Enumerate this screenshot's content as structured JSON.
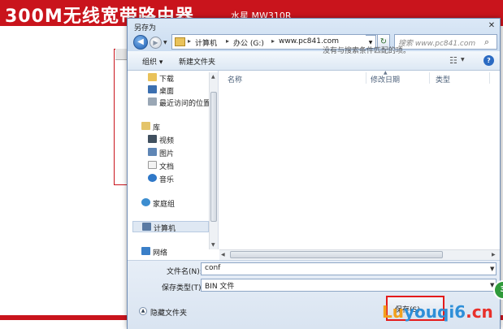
{
  "router_page": {
    "title": "300M无线宽带路由器",
    "model": "水星 MW310R"
  },
  "dialog": {
    "title": "另存为",
    "address": {
      "crumbs": [
        "计算机",
        "办公 (G:)",
        "www.pc841.com"
      ],
      "separator": "▸"
    },
    "search_placeholder": "搜索 www.pc841.com",
    "toolbar": {
      "organize": "组织 ▾",
      "new_folder": "新建文件夹"
    },
    "nav_pane": {
      "items": [
        {
          "label": "下载",
          "icon": "download-folder-icon"
        },
        {
          "label": "桌面",
          "icon": "desktop-icon"
        },
        {
          "label": "最近访问的位置",
          "icon": "recent-places-icon"
        },
        {
          "label": "库",
          "icon": "library-icon"
        },
        {
          "label": "视频",
          "icon": "video-library-icon"
        },
        {
          "label": "图片",
          "icon": "pictures-library-icon"
        },
        {
          "label": "文档",
          "icon": "documents-library-icon"
        },
        {
          "label": "音乐",
          "icon": "music-library-icon"
        },
        {
          "label": "家庭组",
          "icon": "homegroup-icon"
        },
        {
          "label": "计算机",
          "icon": "computer-icon"
        },
        {
          "label": "网络",
          "icon": "network-icon"
        }
      ]
    },
    "columns": [
      "名称",
      "修改日期",
      "类型"
    ],
    "empty_message": "没有与搜索条件匹配的项。",
    "form": {
      "filename_label": "文件名(N):",
      "filename_value": "conf",
      "filetype_label": "保存类型(T):",
      "filetype_value": "BIN 文件"
    },
    "hide_folders": "隐藏文件夹",
    "save_label": "保存(S)"
  },
  "watermark": {
    "part1": "Lu",
    "part2": "youqi6",
    "part3": ".cn"
  },
  "badge": "3"
}
